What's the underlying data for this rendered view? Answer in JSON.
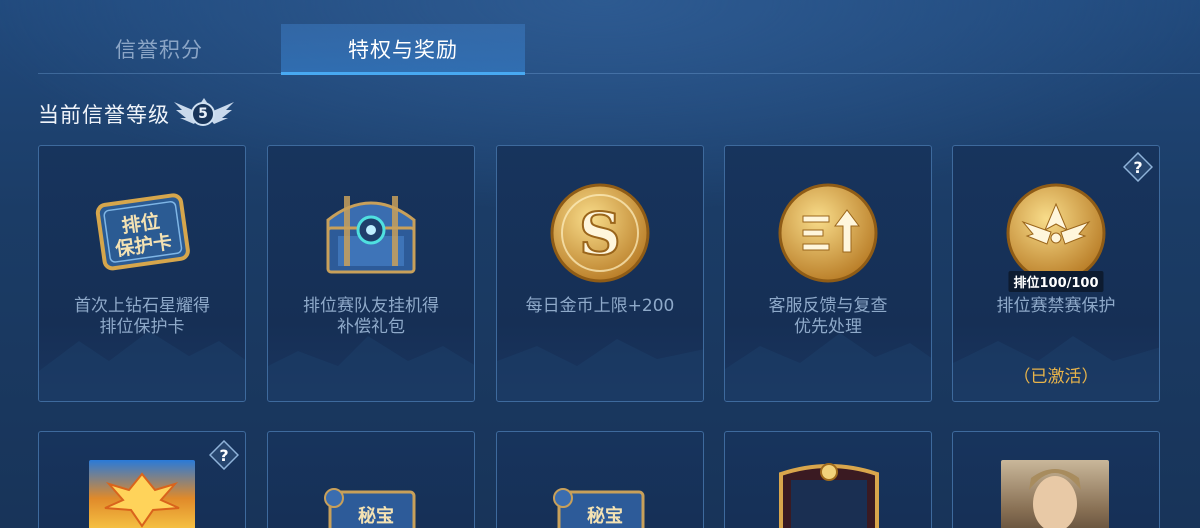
{
  "tabs": [
    {
      "label": "信誉积分",
      "active": false
    },
    {
      "label": "特权与奖励",
      "active": true
    }
  ],
  "level": {
    "title": "当前信誉等级",
    "value": "5"
  },
  "cards": [
    {
      "label_line1": "首次上钻石星耀得",
      "label_line2": "排位保护卡",
      "icon": "rank-protection-card-icon",
      "icon_text": "排位\n保护卡"
    },
    {
      "label_line1": "排位赛队友挂机得",
      "label_line2": "补偿礼包",
      "icon": "treasure-chest-icon"
    },
    {
      "label_line1": "每日金币上限+200",
      "label_line2": "",
      "icon": "gold-coin-icon"
    },
    {
      "label_line1": "客服反馈与复查",
      "label_line2": "优先处理",
      "icon": "priority-service-icon"
    },
    {
      "label_line1": "排位赛禁赛保护",
      "label_line2": "",
      "icon": "ban-protection-icon",
      "caption": "排位100/100",
      "status": "（已激活）",
      "has_help": true
    }
  ],
  "icon_text": {
    "scroll": "秘宝"
  },
  "colors": {
    "accent": "#48a9f2",
    "gold": "#e8b44a",
    "label": "#8ea9c9"
  }
}
